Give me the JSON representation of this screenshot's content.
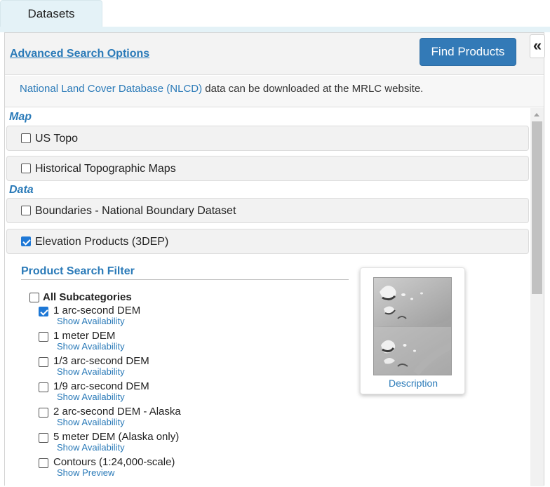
{
  "tabs": [
    {
      "label": "Datasets"
    }
  ],
  "header": {
    "advanced_search_label": "Advanced Search Options",
    "find_products_label": "Find Products",
    "collapse_label": "«"
  },
  "info": {
    "link_text": "National Land Cover Database (NLCD)",
    "rest_text": " data can be downloaded at the MRLC website."
  },
  "sections": {
    "map_label": "Map",
    "data_label": "Data"
  },
  "items": [
    {
      "label": "US Topo",
      "checked": false
    },
    {
      "label": "Historical Topographic Maps",
      "checked": false
    },
    {
      "label": "Boundaries - National Boundary Dataset",
      "checked": false
    },
    {
      "label": "Elevation Products (3DEP)",
      "checked": true
    }
  ],
  "filter": {
    "title": "Product Search Filter",
    "all_label": "All Subcategories",
    "subcategories": [
      {
        "label": "1 arc-second DEM",
        "link": "Show Availability",
        "checked": true
      },
      {
        "label": "1 meter DEM",
        "link": "Show Availability",
        "checked": false
      },
      {
        "label": "1/3 arc-second DEM",
        "link": "Show Availability",
        "checked": false
      },
      {
        "label": "1/9 arc-second DEM",
        "link": "Show Availability",
        "checked": false
      },
      {
        "label": "2 arc-second DEM - Alaska",
        "link": "Show Availability",
        "checked": false
      },
      {
        "label": "5 meter DEM (Alaska only)",
        "link": "Show Availability",
        "checked": false
      },
      {
        "label": "Contours (1:24,000-scale)",
        "link": "Show Preview",
        "checked": false
      }
    ]
  },
  "description": {
    "link_label": "Description"
  },
  "colors": {
    "accent": "#2a7ab8",
    "button": "#337ab7",
    "checkbox_checked": "#1e78d6"
  }
}
